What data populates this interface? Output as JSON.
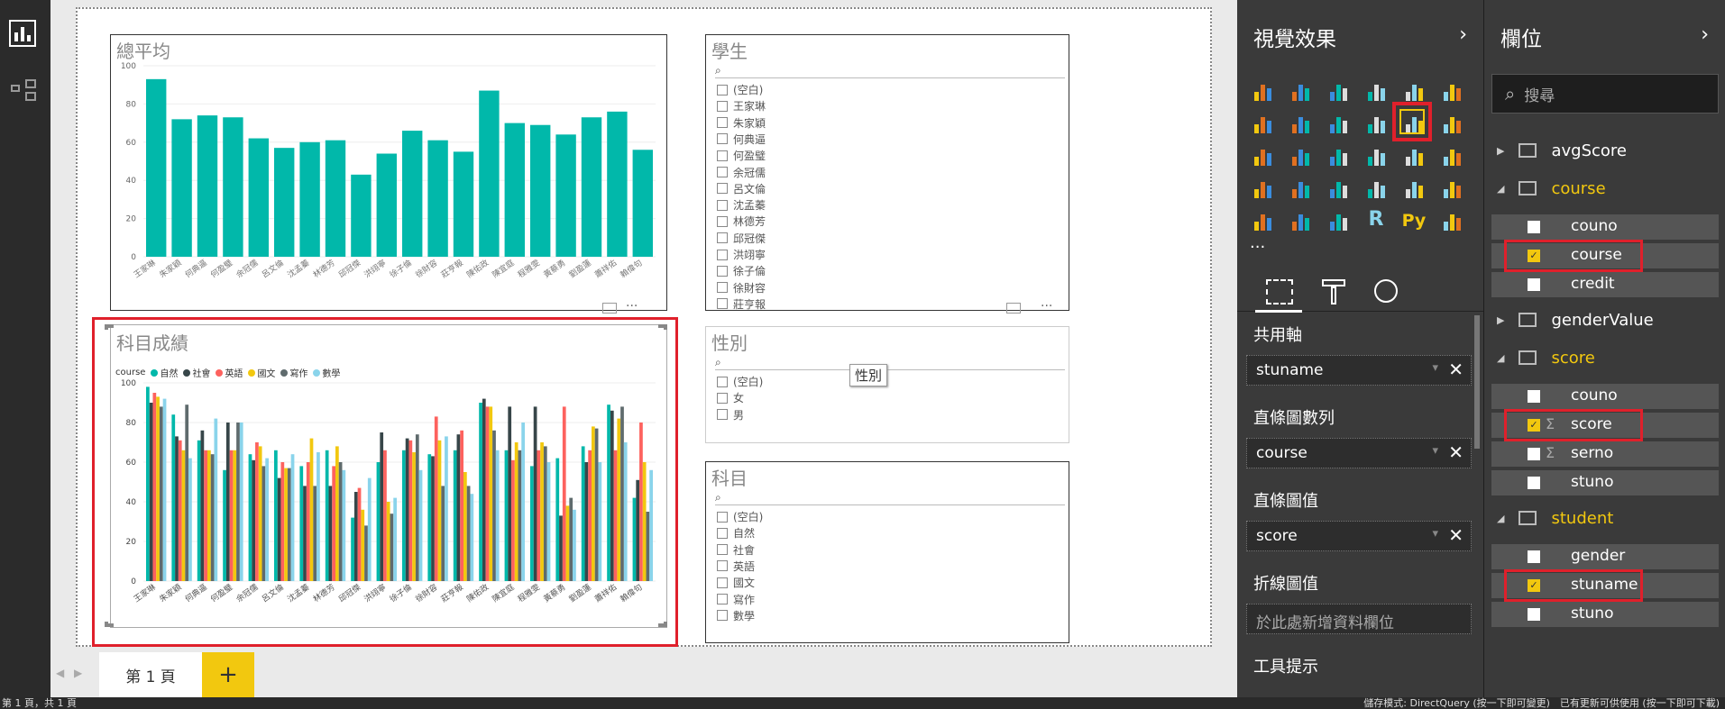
{
  "colors": {
    "teal": "#01b8aa",
    "dark": "#374649",
    "red": "#fd625e",
    "yellow": "#f2c80f",
    "grey": "#5f6b6d",
    "lightblue": "#8ad4eb",
    "highlight": "#e0202b",
    "accent_gold": "#f2c80f"
  },
  "left_rail": {
    "icons": [
      "report-view-icon",
      "model-view-icon"
    ]
  },
  "students": [
    "王家琳",
    "朱家穎",
    "何典逼",
    "何盈璧",
    "余冠儒",
    "呂文倫",
    "沈孟蓁",
    "林德芳",
    "邱冠傑",
    "洪翊寧",
    "徐子倫",
    "徐財容",
    "莊亨報",
    "陳佑政",
    "陳宜庭",
    "程雅雯",
    "黃蔡勇",
    "劉盈蓮",
    "蕭祥佑",
    "賴偉句"
  ],
  "avg_chart": {
    "title": "總平均",
    "chart_data": {
      "type": "bar",
      "categories": [
        "王家琳",
        "朱家穎",
        "何典逼",
        "何盈璧",
        "余冠儒",
        "呂文倫",
        "沈孟蓁",
        "林德芳",
        "邱冠傑",
        "洪翊寧",
        "徐子倫",
        "徐財容",
        "莊亨報",
        "陳佑政",
        "陳宜庭",
        "程雅雯",
        "黃蔡勇",
        "劉盈蓮",
        "蕭祥佑",
        "賴偉句"
      ],
      "values": [
        93,
        72,
        74,
        73,
        62,
        57,
        60,
        61,
        43,
        54,
        66,
        61,
        55,
        87,
        70,
        69,
        64,
        73,
        76,
        56
      ],
      "ylim": [
        0,
        100
      ],
      "yticks": [
        0,
        20,
        40,
        60,
        80,
        100
      ]
    }
  },
  "subject_chart": {
    "title": "科目成績",
    "legend_title": "course",
    "chart_data": {
      "type": "bar",
      "categories": [
        "王家琳",
        "朱家穎",
        "何典逼",
        "何盈璧",
        "余冠儒",
        "呂文倫",
        "沈孟蓁",
        "林德芳",
        "邱冠傑",
        "洪翊寧",
        "徐子倫",
        "徐財容",
        "莊亨報",
        "陳佑政",
        "陳宜庭",
        "程雅雯",
        "黃蔡勇",
        "劉盈蓮",
        "蕭祥佑",
        "賴偉句"
      ],
      "ylim": [
        0,
        100
      ],
      "yticks": [
        0,
        20,
        40,
        60,
        80,
        100
      ],
      "series": [
        {
          "name": "自然",
          "color": "#01b8aa",
          "values": [
            98,
            84,
            71,
            56,
            64,
            66,
            58,
            66,
            32,
            60,
            66,
            64,
            66,
            90,
            66,
            58,
            62,
            68,
            89,
            42
          ]
        },
        {
          "name": "社會",
          "color": "#374649",
          "values": [
            90,
            73,
            76,
            80,
            61,
            52,
            48,
            48,
            45,
            75,
            72,
            63,
            74,
            92,
            88,
            88,
            33,
            60,
            86,
            51
          ]
        },
        {
          "name": "英語",
          "color": "#fd625e",
          "values": [
            95,
            71,
            66,
            66,
            70,
            60,
            60,
            58,
            47,
            66,
            71,
            83,
            76,
            88,
            61,
            66,
            88,
            66,
            66,
            80
          ]
        },
        {
          "name": "國文",
          "color": "#f2c80f",
          "values": [
            93,
            66,
            66,
            66,
            68,
            57,
            72,
            68,
            36,
            40,
            65,
            71,
            55,
            88,
            70,
            70,
            38,
            78,
            82,
            60
          ]
        },
        {
          "name": "寫作",
          "color": "#5f6b6d",
          "values": [
            88,
            89,
            64,
            80,
            58,
            57,
            48,
            60,
            28,
            34,
            74,
            48,
            48,
            76,
            66,
            68,
            42,
            77,
            88,
            35
          ]
        },
        {
          "name": "數學",
          "color": "#8ad4eb",
          "values": [
            92,
            62,
            82,
            80,
            62,
            64,
            65,
            56,
            52,
            42,
            56,
            73,
            44,
            66,
            80,
            60,
            36,
            60,
            70,
            56
          ]
        }
      ]
    }
  },
  "slicer_student": {
    "title": "學生",
    "items": [
      "(空白)",
      "王家琳",
      "朱家穎",
      "何典逼",
      "何盈璧",
      "余冠儒",
      "呂文倫",
      "沈孟蓁",
      "林德芳",
      "邱冠傑",
      "洪翊寧",
      "徐子倫",
      "徐財容",
      "莊亨報"
    ]
  },
  "slicer_gender": {
    "title": "性別",
    "items": [
      "(空白)",
      "女",
      "男"
    ],
    "tooltip": "性別"
  },
  "slicer_subject": {
    "title": "科目",
    "items": [
      "(空白)",
      "自然",
      "社會",
      "英語",
      "國文",
      "寫作",
      "數學"
    ]
  },
  "tabs": {
    "page1": "第 1 頁",
    "add": "+"
  },
  "status": {
    "left": "第 1 頁，共 1 頁",
    "right": "儲存模式: DirectQuery (按一下即可變更)　已有更新可供使用 (按一下即可下載)"
  },
  "viz_pane": {
    "title": "視覺效果",
    "chevron": "›",
    "more": "···",
    "tool_icons": [
      "fields-tab-icon",
      "format-paint-icon",
      "analytics-icon"
    ],
    "wells": [
      {
        "label": "共用軸",
        "value": "stuname"
      },
      {
        "label": "直條圖數列",
        "value": "course"
      },
      {
        "label": "直條圖值",
        "value": "score"
      },
      {
        "label": "折線圖值",
        "placeholder": "於此處新增資料欄位"
      },
      {
        "label": "工具提示"
      }
    ]
  },
  "fields_pane": {
    "title": "欄位",
    "chevron": "›",
    "search_placeholder": "搜尋",
    "tables": [
      {
        "name": "avgScore",
        "expanded": false
      },
      {
        "name": "course",
        "expanded": true,
        "fields": [
          {
            "name": "couno",
            "checked": false
          },
          {
            "name": "course",
            "checked": true
          },
          {
            "name": "credit",
            "checked": false
          }
        ]
      },
      {
        "name": "genderValue",
        "expanded": false
      },
      {
        "name": "score",
        "expanded": true,
        "fields": [
          {
            "name": "couno",
            "checked": false
          },
          {
            "name": "score",
            "checked": true,
            "sigma": true
          },
          {
            "name": "serno",
            "checked": false,
            "sigma": true
          },
          {
            "name": "stuno",
            "checked": false
          }
        ]
      },
      {
        "name": "student",
        "expanded": true,
        "fields": [
          {
            "name": "gender",
            "checked": false
          },
          {
            "name": "stuname",
            "checked": true
          },
          {
            "name": "stuno",
            "checked": false
          }
        ]
      }
    ]
  }
}
